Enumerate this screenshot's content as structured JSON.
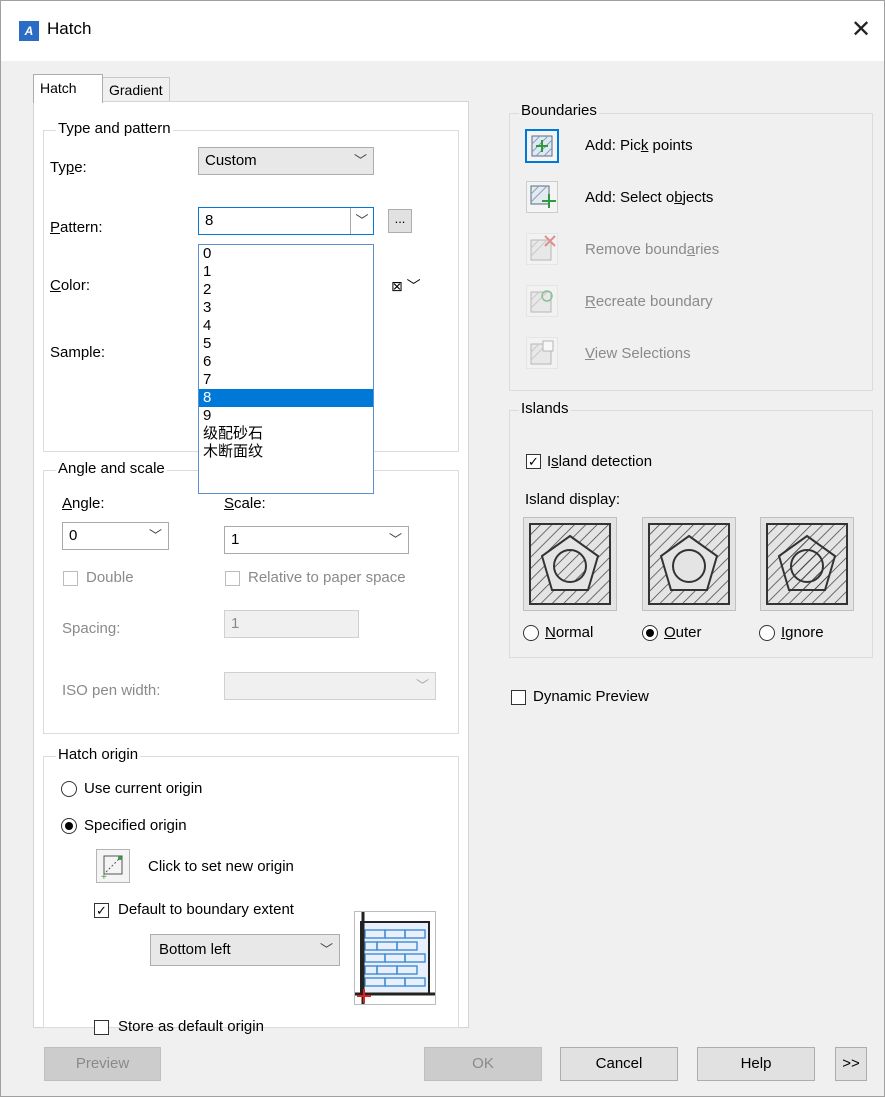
{
  "window": {
    "title": "Hatch",
    "icon": "hatch-app-icon"
  },
  "tabs": [
    {
      "label": "Hatch",
      "active": true
    },
    {
      "label": "Gradient",
      "active": false
    }
  ],
  "type_pattern": {
    "group_title": "Type and pattern",
    "type_label": "Type:",
    "type_value": "Custom",
    "pattern_label": "Pattern:",
    "pattern_value": "8",
    "color_label": "Color:",
    "sample_label": "Sample:",
    "pattern_options": [
      "0",
      "1",
      "2",
      "3",
      "4",
      "5",
      "6",
      "7",
      "8",
      "9",
      "级配砂石",
      "木断面纹"
    ],
    "pattern_selected": "8",
    "browse_label": "..."
  },
  "angle_scale": {
    "group_title": "Angle and scale",
    "angle_label": "Angle:",
    "angle_value": "0",
    "scale_label": "Scale:",
    "scale_value": "1",
    "double_label": "Double",
    "relative_label": "Relative to paper space",
    "spacing_label": "Spacing:",
    "spacing_value": "1",
    "iso_label": "ISO pen width:"
  },
  "hatch_origin": {
    "group_title": "Hatch origin",
    "use_current": "Use current origin",
    "specified": "Specified origin",
    "click_set": "Click to set new origin",
    "default_boundary": "Default to boundary extent",
    "position_value": "Bottom left",
    "store_default": "Store as default origin"
  },
  "boundaries": {
    "group_title": "Boundaries",
    "add_pick": "Add: Pick points",
    "add_select": "Add: Select objects",
    "remove": "Remove boundaries",
    "recreate": "Recreate boundary",
    "view": "View Selections"
  },
  "islands": {
    "group_title": "Islands",
    "detection": "Island detection",
    "display_label": "Island display:",
    "normal": "Normal",
    "outer": "Outer",
    "ignore": "Ignore",
    "selected": "Outer"
  },
  "dynamic_preview": "Dynamic Preview",
  "footer": {
    "preview": "Preview",
    "ok": "OK",
    "cancel": "Cancel",
    "help": "Help",
    "more": ">>"
  }
}
